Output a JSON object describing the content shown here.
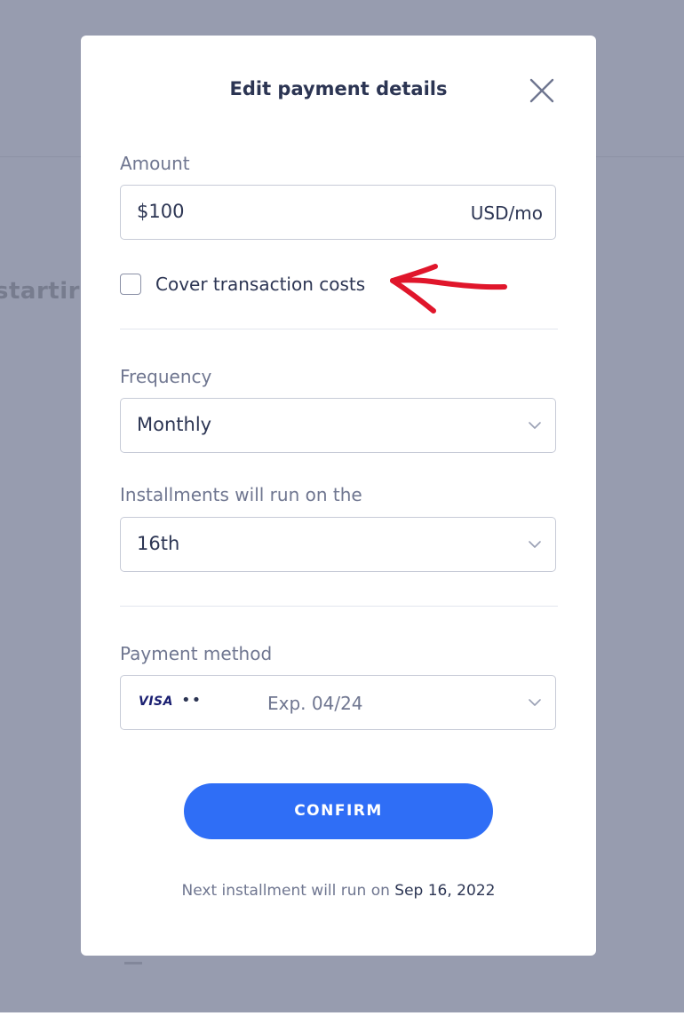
{
  "background": {
    "partial_heading": "startir"
  },
  "modal": {
    "title": "Edit payment details",
    "close_icon": "close-icon",
    "amount": {
      "label": "Amount",
      "value": "$100",
      "suffix": "USD/mo"
    },
    "cover_costs": {
      "label": "Cover transaction costs",
      "checked": false
    },
    "frequency": {
      "label": "Frequency",
      "selected": "Monthly"
    },
    "installment_day": {
      "label": "Installments will run on the",
      "selected": "16th"
    },
    "payment_method": {
      "label": "Payment method",
      "card_brand": "VISA",
      "card_masked": "••",
      "expiry": "Exp. 04/24"
    },
    "confirm_label": "CONFIRM",
    "next_installment": {
      "prefix": "Next installment will run on",
      "date": "Sep 16, 2022"
    }
  },
  "colors": {
    "overlay": "#979caf",
    "accent": "#2f6ef6",
    "annotation_arrow": "#e0162b"
  }
}
